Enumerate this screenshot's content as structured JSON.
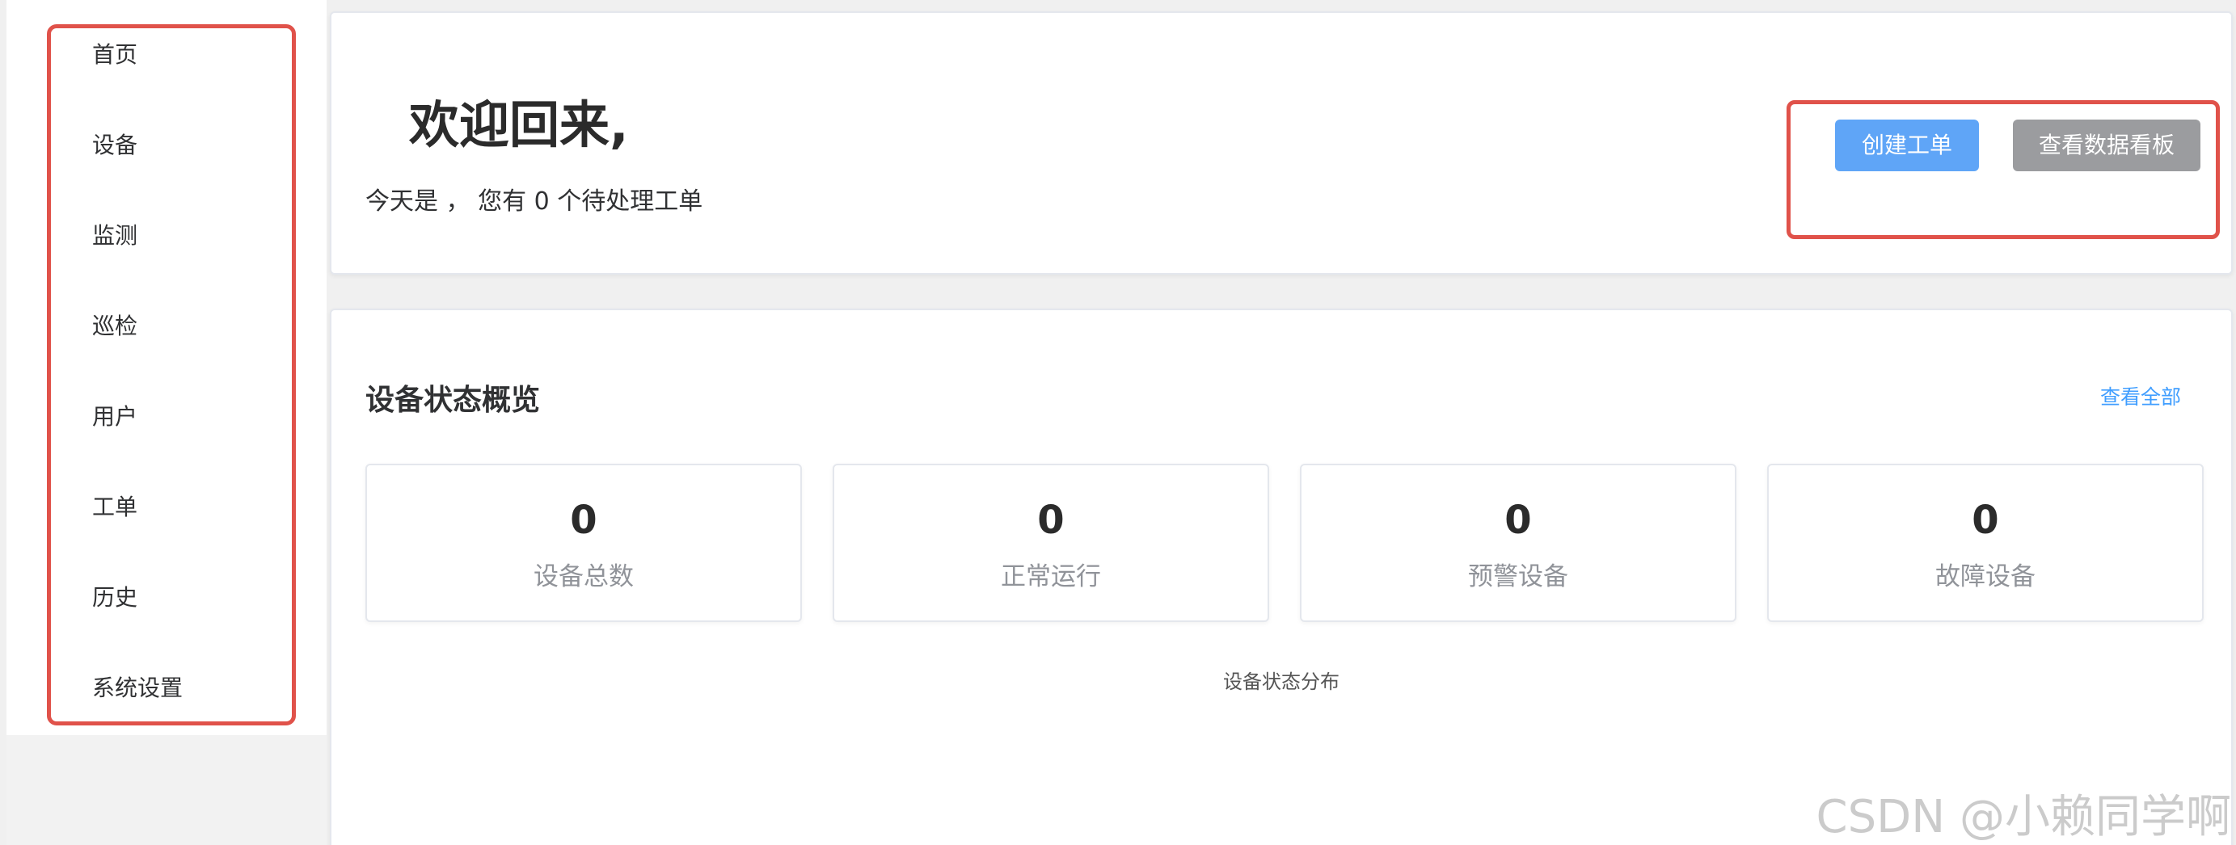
{
  "sidebar": {
    "items": [
      {
        "label": "首页"
      },
      {
        "label": "设备"
      },
      {
        "label": "监测"
      },
      {
        "label": "巡检"
      },
      {
        "label": "用户"
      },
      {
        "label": "工单"
      },
      {
        "label": "历史"
      },
      {
        "label": "系统设置"
      }
    ]
  },
  "welcome": {
    "title": "欢迎回来,",
    "subtitle": "今天是 ， 您有 0 个待处理工单"
  },
  "actions": {
    "create_label": "创建工单",
    "dashboard_label": "查看数据看板"
  },
  "overview": {
    "title": "设备状态概览",
    "view_all": "查看全部",
    "stats": [
      {
        "value": "0",
        "label": "设备总数"
      },
      {
        "value": "0",
        "label": "正常运行"
      },
      {
        "value": "0",
        "label": "预警设备"
      },
      {
        "value": "0",
        "label": "故障设备"
      }
    ],
    "chart_title": "设备状态分布"
  },
  "watermark": "CSDN @小赖同学啊",
  "colors": {
    "highlight": "#e0524a",
    "primary": "#5fa5f7",
    "secondary": "#9b9c9f",
    "link": "#409eff"
  }
}
